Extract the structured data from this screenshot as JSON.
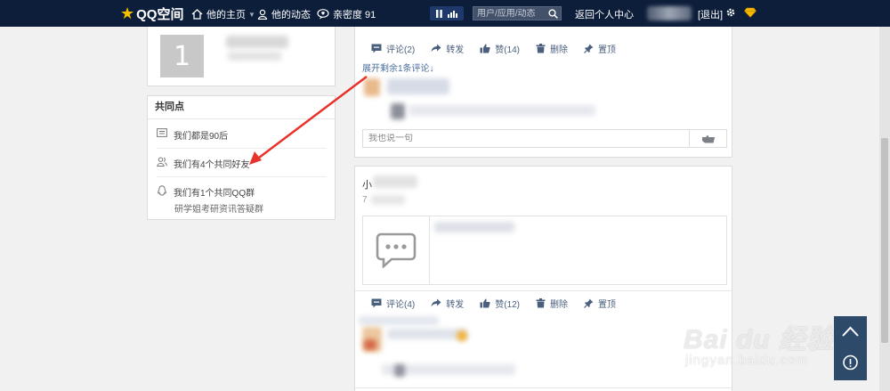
{
  "topbar": {
    "logo_text": "QQ空间",
    "nav": [
      {
        "label": "他的主页",
        "icon": "home-icon"
      },
      {
        "label": "他的动态",
        "icon": "person-icon"
      },
      {
        "label": "亲密度 91",
        "icon": "heart-chat-icon"
      }
    ],
    "search_placeholder": "用户/应用/动态",
    "return_label": "返回个人中心",
    "logout_label": "[退出]"
  },
  "left": {
    "rank_number": "1",
    "common_title": "共同点",
    "common_items": [
      {
        "label": "我们都是90后",
        "icon": "id-card-icon"
      },
      {
        "label": "我们有4个共同好友",
        "icon": "friends-icon"
      },
      {
        "label": "我们有1个共同QQ群",
        "icon": "qq-penguin-icon",
        "sub": "研学姐考研资讯答疑群"
      }
    ]
  },
  "feed": [
    {
      "actions": [
        {
          "label": "评论(2)",
          "icon": "comment-icon"
        },
        {
          "label": "转发",
          "icon": "forward-icon"
        },
        {
          "label": "赞(14)",
          "icon": "thumbs-up-icon"
        },
        {
          "label": "删除",
          "icon": "trash-icon"
        },
        {
          "label": "置顶",
          "icon": "pin-icon"
        }
      ],
      "expand_label": "展开剩余1条评论↓",
      "reply_placeholder": "我也说一句"
    },
    {
      "author_initial": "小",
      "time_initial": "7",
      "actions": [
        {
          "label": "评论(4)",
          "icon": "comment-icon"
        },
        {
          "label": "转发",
          "icon": "forward-icon"
        },
        {
          "label": "赞(12)",
          "icon": "thumbs-up-icon"
        },
        {
          "label": "删除",
          "icon": "trash-icon"
        },
        {
          "label": "置顶",
          "icon": "pin-icon"
        }
      ]
    }
  ],
  "watermark": {
    "main": "Bai du 经验",
    "sub": "jingyan.baidu.com"
  },
  "colors": {
    "topbar": "#0d1e3b",
    "accent_arrow": "#e8322c",
    "action_text": "#4a5f7e"
  }
}
